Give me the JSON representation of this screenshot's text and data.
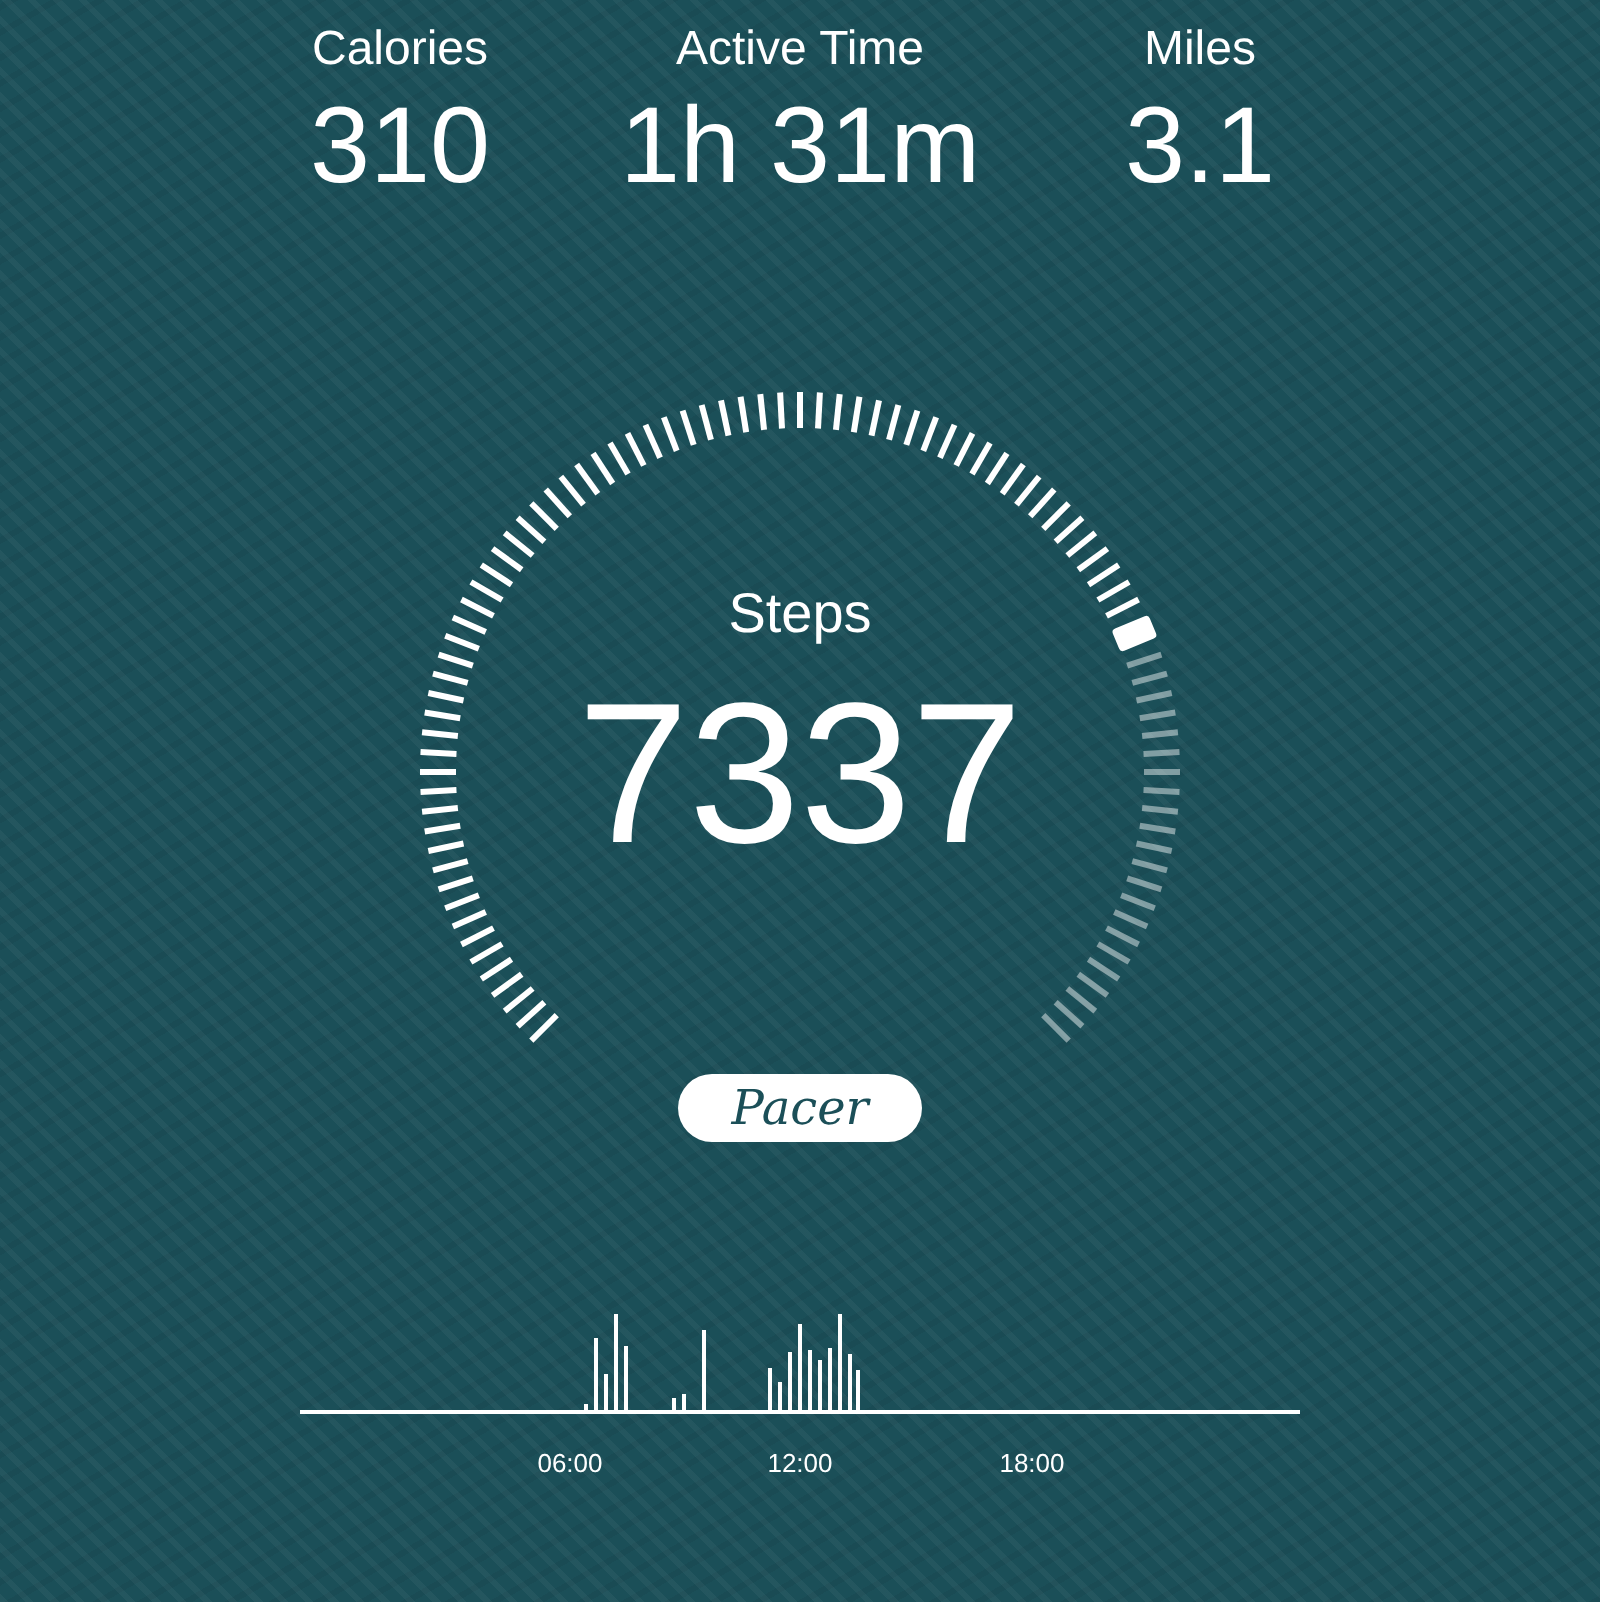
{
  "stats": [
    {
      "label": "Calories",
      "value": "310"
    },
    {
      "label": "Active Time",
      "value": "1h 31m"
    },
    {
      "label": "Miles",
      "value": "3.1"
    }
  ],
  "steps": {
    "label": "Steps",
    "value": "7337"
  },
  "brand": "Pacer",
  "timeline": {
    "ticks": [
      "06:00",
      "12:00",
      "18:00"
    ]
  }
}
